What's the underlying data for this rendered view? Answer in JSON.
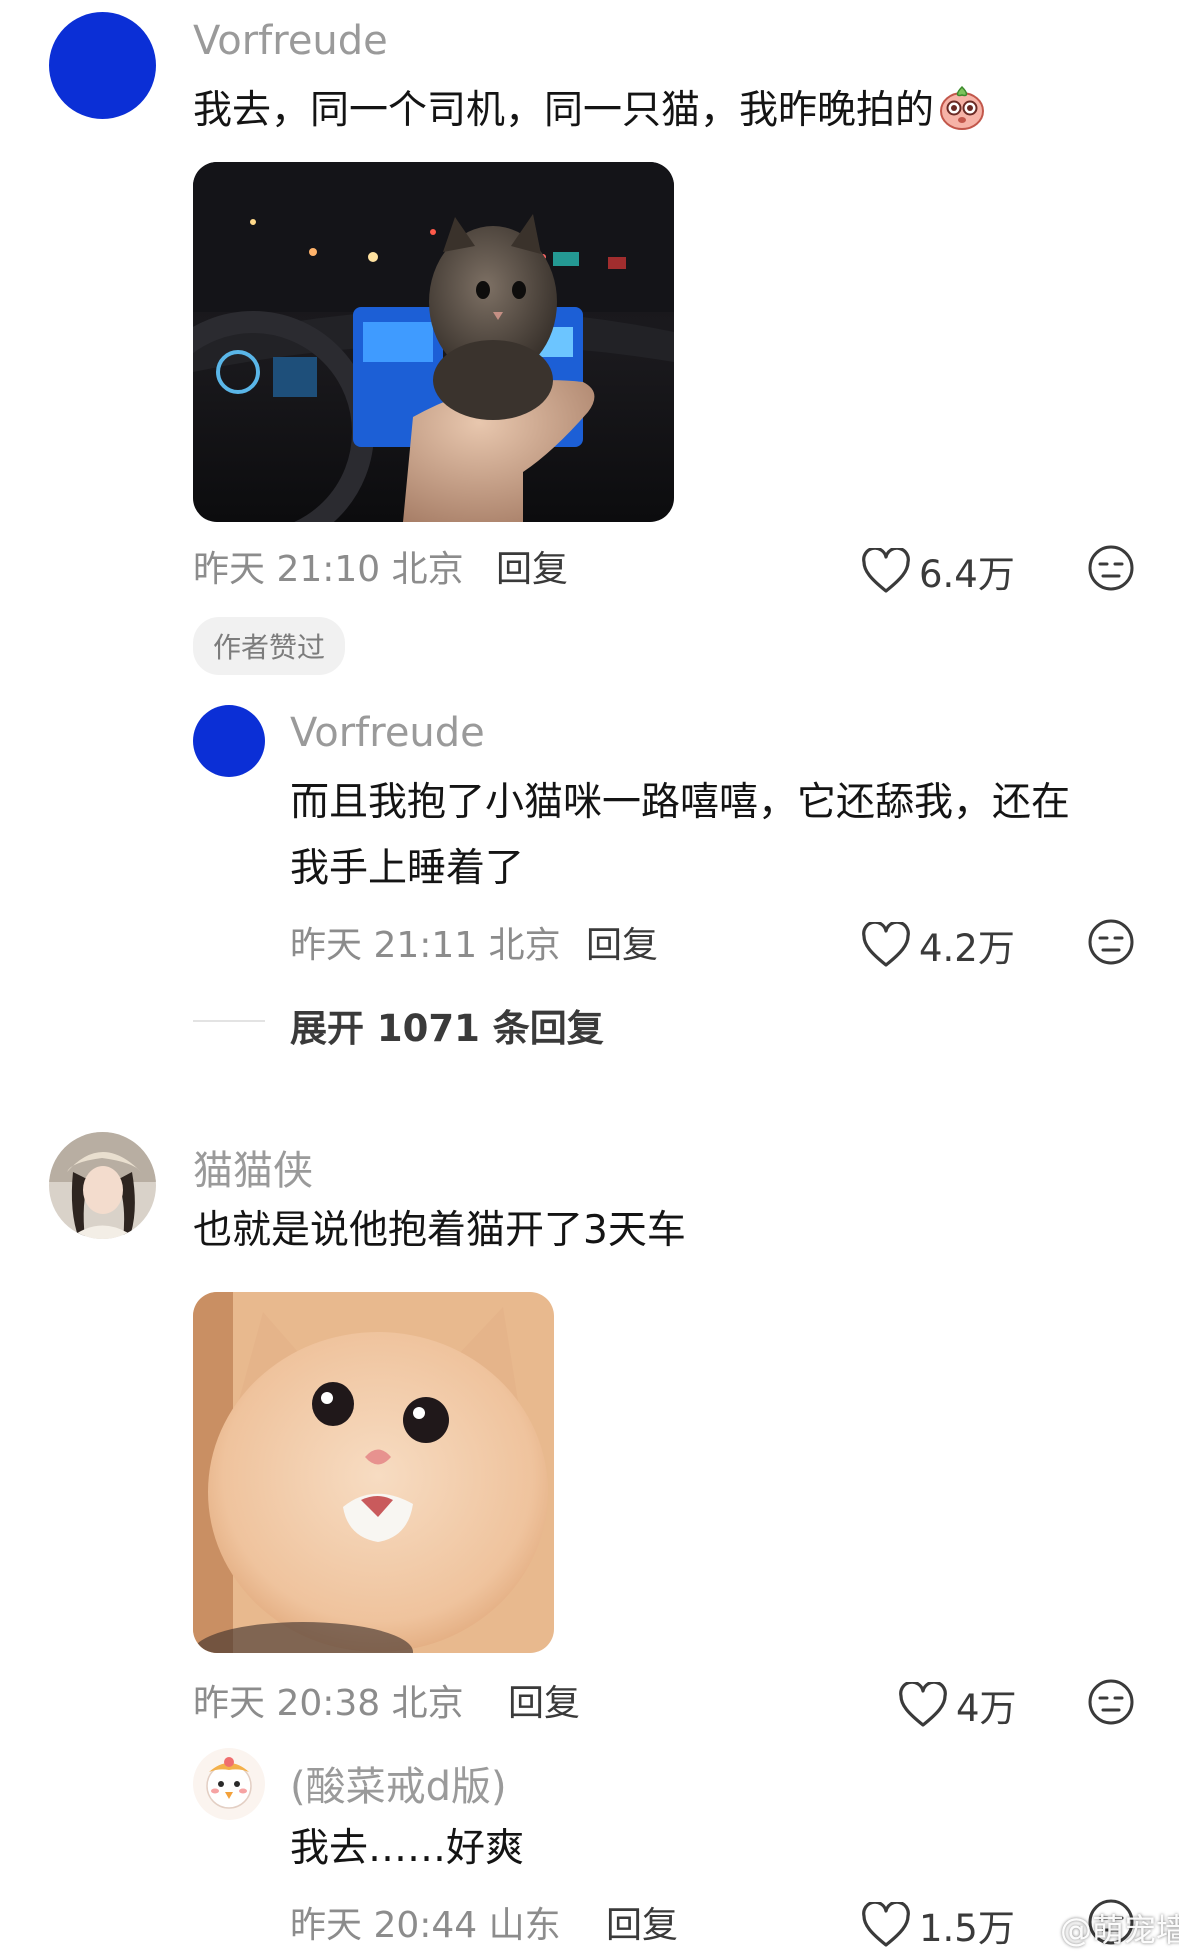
{
  "comments": [
    {
      "user": "Vorfreude",
      "text": "我去，同一个司机，同一只猫，我昨晚拍的",
      "emoji": "peach-face-emoji",
      "image": "photo-kitten-in-car",
      "time": "昨天 21:10",
      "location": "北京",
      "reply_label": "回复",
      "likes": "6.4万",
      "badge": "作者赞过",
      "replies": [
        {
          "user": "Vorfreude",
          "text_line1": "而且我抱了小猫咪一路嘻嘻，它还舔我，还在",
          "text_line2": "我手上睡着了",
          "time": "昨天 21:11",
          "location": "北京",
          "reply_label": "回复",
          "likes": "4.2万"
        }
      ],
      "expand_label": "展开 1071 条回复"
    },
    {
      "user": "猫猫侠",
      "text": "也就是说他抱着猫开了3天车",
      "image": "photo-crying-kitten",
      "time": "昨天 20:38",
      "location": "北京",
      "reply_label": "回复",
      "likes": "4万",
      "replies": [
        {
          "user": "(酸菜戒d版)",
          "text": "我去……好爽",
          "time": "昨天 20:44",
          "location": "山东",
          "reply_label": "回复",
          "likes": "1.5万"
        }
      ]
    }
  ],
  "watermark": "@萌宠墙",
  "colors": {
    "avatar_blue": "#0b2fd6",
    "meta_gray": "#8c8c8c"
  }
}
